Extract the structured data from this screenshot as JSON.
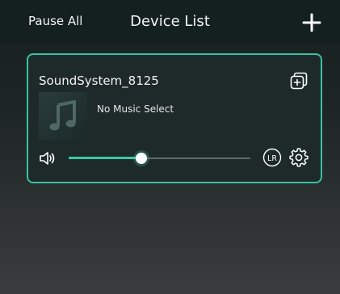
{
  "header": {
    "pause_all_label": "Pause All",
    "title": "Device List",
    "add_icon": "plus-icon"
  },
  "device": {
    "name": "SoundSystem_8125",
    "track_status": "No Music Select",
    "group_icon": "group-add-icon",
    "cover_icon": "music-note-icon",
    "volume_icon": "speaker-volume-icon",
    "volume_level": 0.4,
    "channel_label": "LR",
    "settings_icon": "gear-icon"
  },
  "colors": {
    "accent": "#39c2a2",
    "background_top": "#172020",
    "background_bottom": "#3a3d3e",
    "card_background": "#1d2a29"
  }
}
